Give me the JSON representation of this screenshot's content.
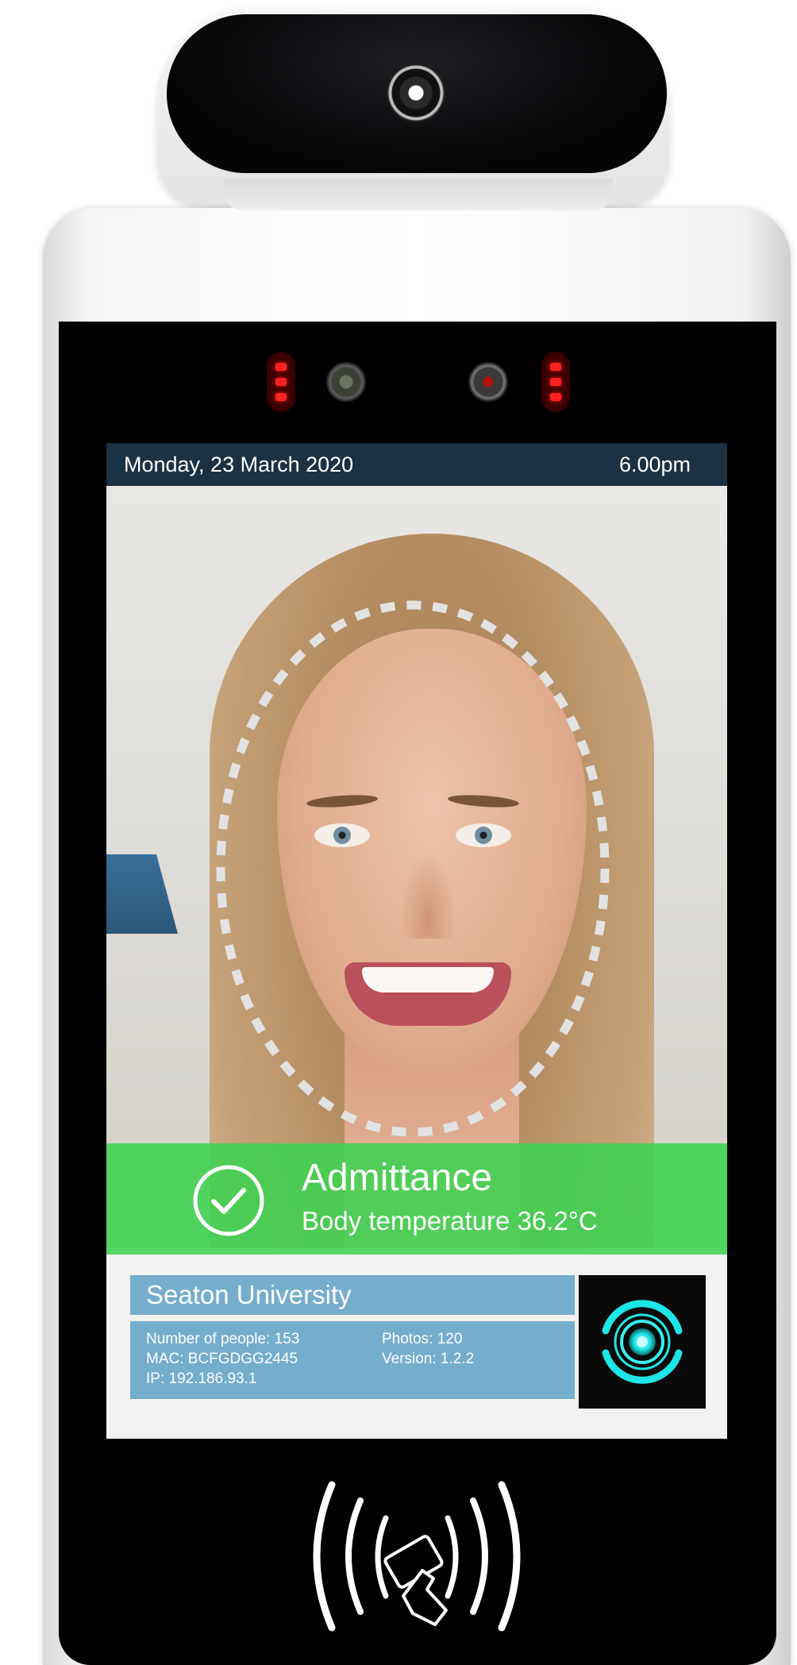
{
  "screen": {
    "status_bar": {
      "date": "Monday, 23 March 2020",
      "time": "6.00pm"
    },
    "result": {
      "status": "Admittance",
      "temperature_text": "Body temperature 36.2°C",
      "status_icon": "check-circle-icon",
      "banner_color": "#3ed250"
    },
    "organization": "Seaton University",
    "device_info": {
      "people_count": "Number of people: 153",
      "mac": "MAC: BCFGDGG2445",
      "ip": "IP: 192.186.93.1",
      "photos": "Photos: 120",
      "version": "Version: 1.2.2"
    },
    "biometric_icon": "fingerprint-scan-icon"
  },
  "hardware": {
    "nfc_icon": "nfc-card-tap-icon",
    "accent_color": "#1ee6e6"
  }
}
